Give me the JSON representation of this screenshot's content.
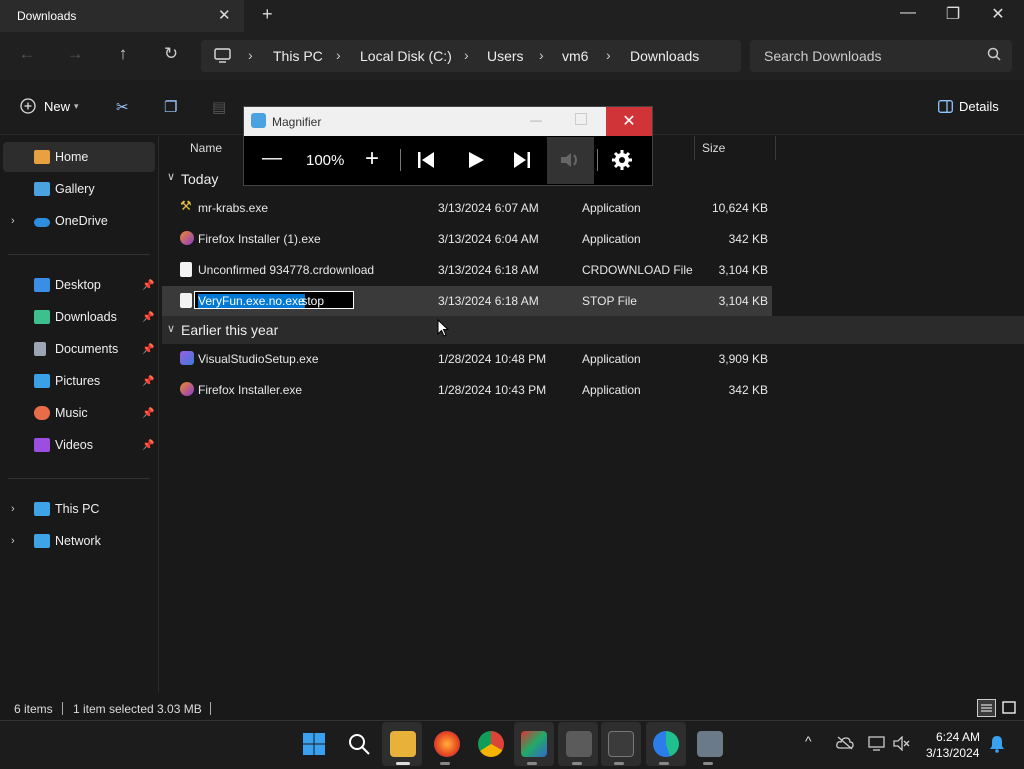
{
  "window": {
    "tab_title": "Downloads",
    "close_glyph": "✕",
    "new_tab_glyph": "+",
    "minimize_glyph": "—",
    "maximize_glyph": "❐",
    "close_window_glyph": "✕"
  },
  "address": {
    "crumbs": [
      "This PC",
      "Local Disk (C:)",
      "Users",
      "vm6",
      "Downloads"
    ],
    "chevron": "›",
    "search_placeholder": "Search Downloads"
  },
  "toolbar": {
    "new_label": "New",
    "details_label": "Details"
  },
  "sidebar": {
    "items": [
      {
        "label": "Home",
        "color": "#e8a040"
      },
      {
        "label": "Gallery",
        "color": "#4aa3e0"
      },
      {
        "label": "OneDrive",
        "color": "#2f8ddf"
      },
      {
        "label": "Desktop",
        "color": "#3a8ee6"
      },
      {
        "label": "Downloads",
        "color": "#3ec08e"
      },
      {
        "label": "Documents",
        "color": "#9aa5b1"
      },
      {
        "label": "Pictures",
        "color": "#3aa0e8"
      },
      {
        "label": "Music",
        "color": "#e86c4a"
      },
      {
        "label": "Videos",
        "color": "#9c4ee0"
      },
      {
        "label": "This PC",
        "color": "#3fa4e6"
      },
      {
        "label": "Network",
        "color": "#3fa4e6"
      }
    ]
  },
  "columns": {
    "name": "Name",
    "size": "Size"
  },
  "groups": {
    "today": "Today",
    "earlier": "Earlier this year"
  },
  "files": [
    {
      "name": "mr-krabs.exe",
      "date": "3/13/2024 6:07 AM",
      "type": "Application",
      "size": "10,624 KB"
    },
    {
      "name": "Firefox Installer (1).exe",
      "date": "3/13/2024 6:04 AM",
      "type": "Application",
      "size": "342 KB"
    },
    {
      "name": "Unconfirmed 934778.crdownload",
      "date": "3/13/2024 6:18 AM",
      "type": "CRDOWNLOAD File",
      "size": "3,104 KB"
    },
    {
      "name_selected": "VeryFun.exe.no.exe",
      "name_rest": ".stop",
      "date": "3/13/2024 6:18 AM",
      "type": "STOP File",
      "size": "3,104 KB"
    },
    {
      "name": "VisualStudioSetup.exe",
      "date": "1/28/2024 10:48 PM",
      "type": "Application",
      "size": "3,909 KB"
    },
    {
      "name": "Firefox Installer.exe",
      "date": "1/28/2024 10:43 PM",
      "type": "Application",
      "size": "342 KB"
    }
  ],
  "magnifier": {
    "title": "Magnifier",
    "zoom": "100%",
    "minus": "—",
    "plus": "+",
    "close": "✕"
  },
  "status": {
    "items": "6 items",
    "selected": "1 item selected  3.03 MB"
  },
  "clock": {
    "time": "6:24 AM",
    "date": "3/13/2024"
  }
}
